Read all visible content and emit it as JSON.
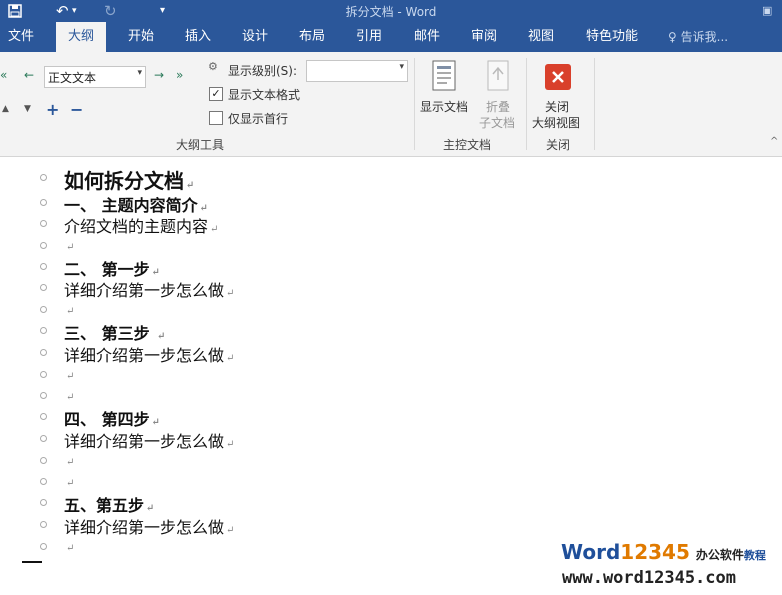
{
  "window": {
    "title": "拆分文档 - Word"
  },
  "quick_access": {
    "save_icon": "save-icon",
    "undo_icon": "undo-icon",
    "redo_icon": "redo-icon",
    "customize_icon": "customize-qa-icon"
  },
  "tabs": [
    {
      "label": "文件"
    },
    {
      "label": "大纲"
    },
    {
      "label": "开始"
    },
    {
      "label": "插入"
    },
    {
      "label": "设计"
    },
    {
      "label": "布局"
    },
    {
      "label": "引用"
    },
    {
      "label": "邮件"
    },
    {
      "label": "审阅"
    },
    {
      "label": "视图"
    },
    {
      "label": "特色功能"
    }
  ],
  "tell_me": {
    "placeholder": "告诉我..."
  },
  "ribbon": {
    "outline_tools": {
      "label": "大纲工具",
      "level_value": "正文文本",
      "show_level_label": "显示级别(S):",
      "show_level_value": "",
      "show_text_format_label": "显示文本格式",
      "show_text_format_checked": true,
      "show_first_line_label": "仅显示首行",
      "show_first_line_checked": false
    },
    "master_doc": {
      "label": "主控文档",
      "show_doc_label": "显示文档",
      "collapse_line1": "折叠",
      "collapse_line2": "子文档"
    },
    "close": {
      "label": "关闭",
      "close_line1": "关闭",
      "close_line2": "大纲视图"
    }
  },
  "outline": [
    {
      "text": "如何拆分文档",
      "style": "heading1"
    },
    {
      "text": "一、  主题内容简介",
      "style": "heading2"
    },
    {
      "text": "介绍文档的主题内容",
      "style": "body"
    },
    {
      "text": "",
      "style": "body"
    },
    {
      "text": "二、  第一步",
      "style": "heading2"
    },
    {
      "text": "详细介绍第一步怎么做",
      "style": "body"
    },
    {
      "text": "",
      "style": "body"
    },
    {
      "text": "三、  第三步 ",
      "style": "heading2"
    },
    {
      "text": "详细介绍第一步怎么做",
      "style": "body"
    },
    {
      "text": "",
      "style": "body"
    },
    {
      "text": "",
      "style": "body"
    },
    {
      "text": "四、  第四步",
      "style": "heading2"
    },
    {
      "text": "详细介绍第一步怎么做",
      "style": "body"
    },
    {
      "text": "",
      "style": "body"
    },
    {
      "text": "",
      "style": "body"
    },
    {
      "text": "五、第五步",
      "style": "heading2"
    },
    {
      "text": "详细介绍第一步怎么做",
      "style": "body"
    },
    {
      "text": "",
      "style": "body"
    }
  ],
  "paragraph_mark": "↵",
  "watermark": {
    "brand_word": "Word",
    "brand_num": "12345",
    "brand_cn": "办公软件",
    "brand_cn2": "教程",
    "url": "www.word12345.com"
  },
  "colors": {
    "accent": "#2b579a",
    "ribbon_bg": "#f3f3f3",
    "close_red": "#d9402b"
  }
}
